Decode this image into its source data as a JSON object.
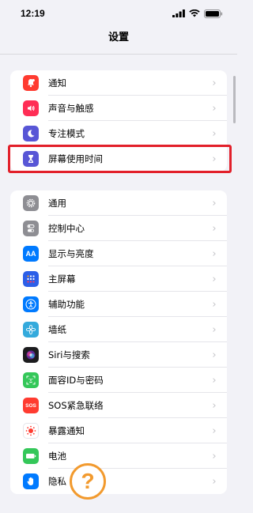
{
  "status_bar": {
    "time": "12:19"
  },
  "header": {
    "title": "设置"
  },
  "group1": [
    {
      "label": "通知",
      "icon": "bell-icon",
      "color": "#ff3b30"
    },
    {
      "label": "声音与触感",
      "icon": "speaker-icon",
      "color": "#ff2d55"
    },
    {
      "label": "专注模式",
      "icon": "moon-icon",
      "color": "#5856d6"
    },
    {
      "label": "屏幕使用时间",
      "icon": "hourglass-icon",
      "color": "#5856d6",
      "highlighted": true
    }
  ],
  "group2": [
    {
      "label": "通用",
      "icon": "gear-icon",
      "color": "#8e8e93"
    },
    {
      "label": "控制中心",
      "icon": "toggles-icon",
      "color": "#8e8e93"
    },
    {
      "label": "显示与亮度",
      "icon": "text-size-icon",
      "color": "#007aff",
      "glyph": "AA"
    },
    {
      "label": "主屏幕",
      "icon": "home-grid-icon",
      "color": "#2c5fe8"
    },
    {
      "label": "辅助功能",
      "icon": "accessibility-icon",
      "color": "#007aff"
    },
    {
      "label": "墙纸",
      "icon": "flower-icon",
      "color": "#34aadc"
    },
    {
      "label": "Siri与搜索",
      "icon": "siri-icon",
      "color": "#1c1c1e"
    },
    {
      "label": "面容ID与密码",
      "icon": "face-id-icon",
      "color": "#34c759"
    },
    {
      "label": "SOS紧急联络",
      "icon": "sos-icon",
      "color": "#ff3b30",
      "glyph": "SOS"
    },
    {
      "label": "暴露通知",
      "icon": "exposure-icon",
      "color": "#ffffff"
    },
    {
      "label": "电池",
      "icon": "battery-icon",
      "color": "#34c759"
    },
    {
      "label": "隐私",
      "icon": "hand-icon",
      "color": "#007aff"
    }
  ],
  "chevron": "›",
  "help_badge": "?",
  "colors": {
    "highlight": "#e2202a",
    "badge": "#f29a2e"
  }
}
